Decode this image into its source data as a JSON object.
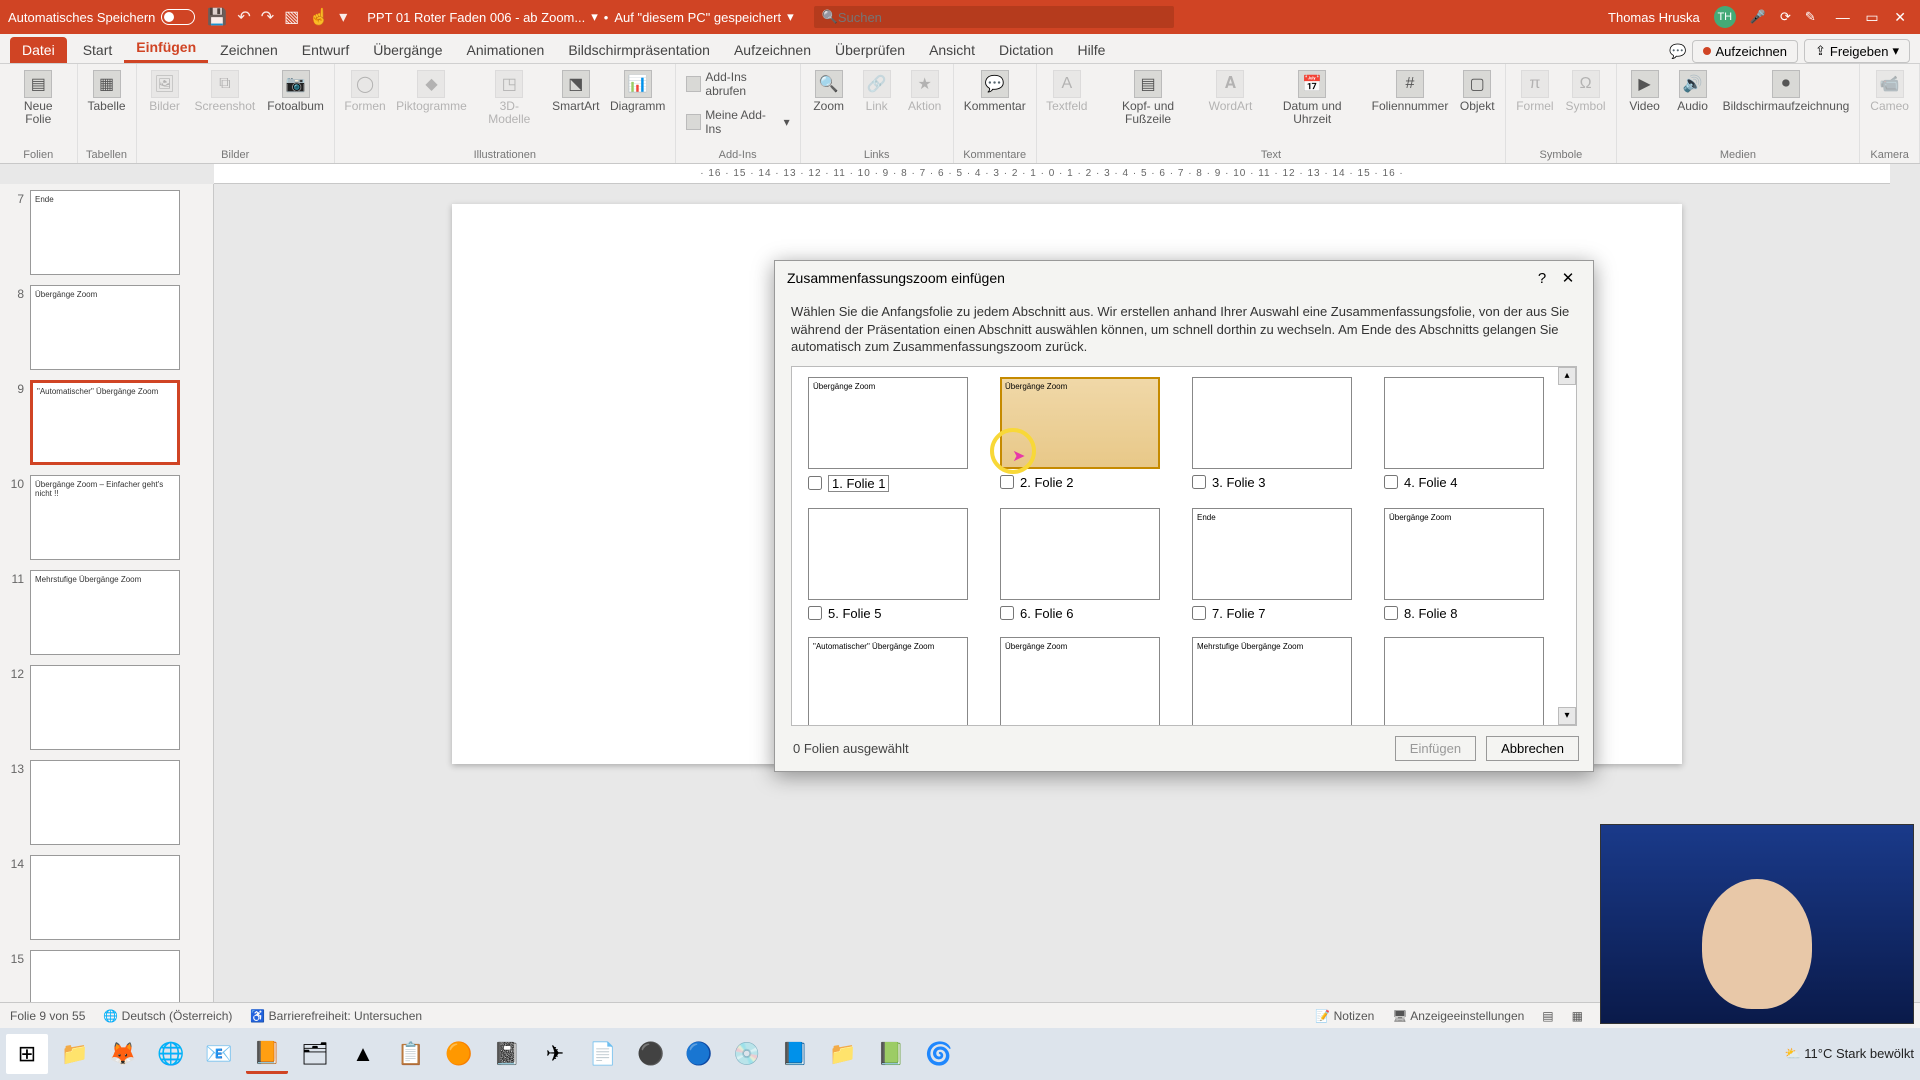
{
  "titlebar": {
    "autosave": "Automatisches Speichern",
    "docname": "PPT 01 Roter Faden 006 - ab Zoom...",
    "saved": "Auf \"diesem PC\" gespeichert",
    "search_ph": "Suchen",
    "user": "Thomas Hruska",
    "initials": "TH"
  },
  "tabs": {
    "file": "Datei",
    "start": "Start",
    "einf": "Einfügen",
    "zeich": "Zeichnen",
    "entw": "Entwurf",
    "uber": "Übergänge",
    "anim": "Animationen",
    "bild": "Bildschirmpräsentation",
    "aufz": "Aufzeichnen",
    "prüf": "Überprüfen",
    "ans": "Ansicht",
    "dict": "Dictation",
    "hilfe": "Hilfe",
    "record": "Aufzeichnen",
    "share": "Freigeben"
  },
  "ribbon": {
    "folien": {
      "name": "Folien",
      "neue": "Neue\nFolie",
      "tabelle": "Tabelle"
    },
    "tabellen": {
      "name": "Tabellen"
    },
    "bilder": {
      "name": "Bilder",
      "b": "Bilder",
      "s": "Screenshot",
      "f": "Fotoalbum"
    },
    "ill": {
      "name": "Illustrationen",
      "formen": "Formen",
      "pikt": "Piktogramme",
      "d3": "3D-\nModelle",
      "sa": "SmartArt",
      "dia": "Diagramm"
    },
    "addins": {
      "name": "Add-Ins",
      "get": "Add-Ins abrufen",
      "my": "Meine Add-Ins"
    },
    "links": {
      "name": "Links",
      "zoom": "Zoom",
      "link": "Link",
      "aktion": "Aktion"
    },
    "komm": {
      "name": "Kommentare",
      "k": "Kommentar"
    },
    "text": {
      "name": "Text",
      "tf": "Textfeld",
      "kf": "Kopf- und\nFußzeile",
      "wa": "WordArt",
      "du": "Datum und\nUhrzeit",
      "fn": "Foliennummer",
      "obj": "Objekt"
    },
    "sym": {
      "name": "Symbole",
      "f": "Formel",
      "s": "Symbol"
    },
    "medien": {
      "name": "Medien",
      "v": "Video",
      "a": "Audio",
      "b": "Bildschirmaufzeichnung"
    },
    "kam": {
      "name": "Kamera",
      "c": "Cameo"
    }
  },
  "thumbs": [
    {
      "n": "7",
      "title": "Ende"
    },
    {
      "n": "8",
      "title": "Übergänge Zoom"
    },
    {
      "n": "9",
      "title": "\"Automatischer\" Übergänge Zoom"
    },
    {
      "n": "10",
      "title": "Übergänge Zoom – Einfacher geht's nicht !!"
    },
    {
      "n": "11",
      "title": "Mehrstufige Übergänge Zoom"
    },
    {
      "n": "12",
      "title": ""
    },
    {
      "n": "13",
      "title": ""
    },
    {
      "n": "14",
      "title": ""
    },
    {
      "n": "15",
      "title": ""
    }
  ],
  "dialog": {
    "title": "Zusammenfassungszoom einfügen",
    "desc": "Wählen Sie die Anfangsfolie zu jedem Abschnitt aus. Wir erstellen anhand Ihrer Auswahl eine Zusammenfassungsfolie, von der aus Sie während der Präsentation einen Abschnitt auswählen können, um schnell dorthin zu wechseln. Am Ende des Abschnitts gelangen Sie automatisch zum Zusammenfassungszoom zurück.",
    "slides": [
      {
        "label": "1. Folie 1",
        "sub": "Übergänge Zoom"
      },
      {
        "label": "2. Folie 2",
        "sub": "Übergänge Zoom"
      },
      {
        "label": "3. Folie 3",
        "sub": ""
      },
      {
        "label": "4. Folie 4",
        "sub": ""
      },
      {
        "label": "5. Folie 5",
        "sub": ""
      },
      {
        "label": "6. Folie 6",
        "sub": ""
      },
      {
        "label": "7. Folie 7",
        "sub": "Ende"
      },
      {
        "label": "8. Folie 8",
        "sub": "Übergänge Zoom"
      },
      {
        "label": "",
        "sub": "\"Automatischer\" Übergänge Zoom"
      },
      {
        "label": "",
        "sub": "Übergänge Zoom"
      },
      {
        "label": "",
        "sub": "Mehrstufige Übergänge Zoom"
      },
      {
        "label": "",
        "sub": ""
      }
    ],
    "count": "0 Folien ausgewählt",
    "insert": "Einfügen",
    "cancel": "Abbrechen"
  },
  "status": {
    "slide": "Folie 9 von 55",
    "lang": "Deutsch (Österreich)",
    "acc": "Barrierefreiheit: Untersuchen",
    "notes": "Notizen",
    "disp": "Anzeigeeinstellungen",
    "zoom": "+"
  },
  "tray": {
    "weather": "11°C  Stark bewölkt"
  }
}
